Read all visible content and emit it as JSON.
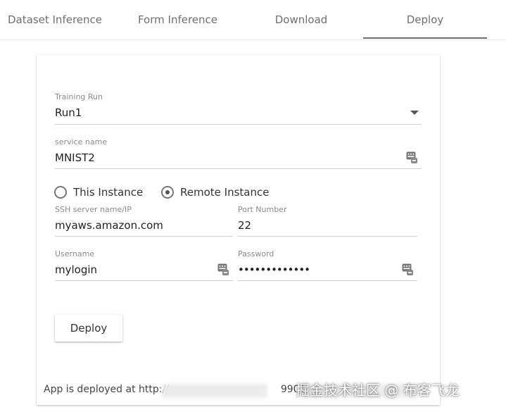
{
  "tabs": [
    {
      "label": "Dataset Inference"
    },
    {
      "label": "Form Inference"
    },
    {
      "label": "Download"
    },
    {
      "label": "Deploy",
      "active": true
    }
  ],
  "form": {
    "training_run": {
      "label": "Training Run",
      "value": "Run1"
    },
    "service_name": {
      "label": "service name",
      "value": "MNIST2"
    },
    "instance": {
      "options": [
        "This Instance",
        "Remote Instance"
      ],
      "selected": "Remote Instance"
    },
    "ssh_server": {
      "label": "SSH server name/IP",
      "value": "myaws.amazon.com"
    },
    "port": {
      "label": "Port Number",
      "value": "22"
    },
    "username": {
      "label": "Username",
      "value": "mylogin"
    },
    "password": {
      "label": "Password",
      "value": "•••••••••••••"
    },
    "deploy_button": "Deploy"
  },
  "status": {
    "text": "App is deployed at http://",
    "partial": "9901/"
  },
  "watermark": "掘金技术社区 @ 布客飞龙",
  "icons": {
    "dropdown": "caret-down-icon",
    "keyboard": "keyboard-icon"
  },
  "colors": {
    "tab_underline": "#6f6f6f",
    "field_line": "#d0d0d0"
  }
}
